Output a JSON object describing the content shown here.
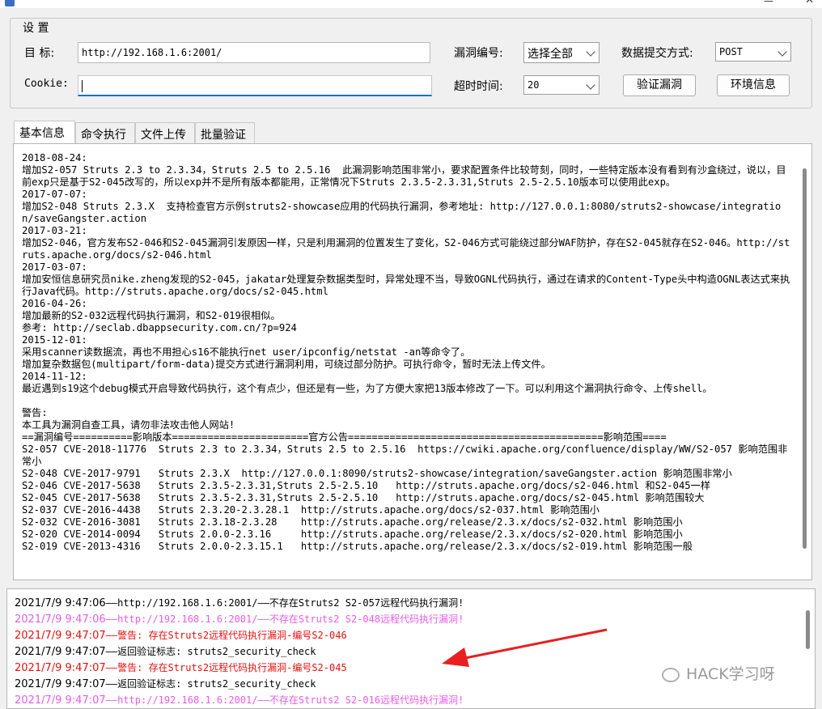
{
  "settings": {
    "legend": "设 置",
    "target_label": "目  标:",
    "target_value": "http://192.168.1.6:2001/",
    "cookie_label": "Cookie:",
    "cookie_value": "",
    "vuln_id_label": "漏洞编号:",
    "vuln_id_selected": "选择全部",
    "submit_method_label": "数据提交方式:",
    "submit_method_selected": "POST",
    "timeout_label": "超时时间:",
    "timeout_selected": "20",
    "verify_button": "验证漏洞",
    "env_button": "环境信息"
  },
  "tabs": [
    "基本信息",
    "命令执行",
    "文件上传",
    "批量验证"
  ],
  "info_text": "2018-08-24:\n增加S2-057 Struts 2.3 to 2.3.34，Struts 2.5 to 2.5.16  此漏洞影响范围非常小，要求配置条件比较苛刻，同时，一些特定版本没有看到有沙盒绕过，说以，目前exp只是基于S2-045改写的，所以exp并不是所有版本都能用，正常情况下Struts 2.3.5-2.3.31,Struts 2.5-2.5.10版本可以使用此exp。\n2017-07-07:\n增加S2-048 Struts 2.3.X  支持检查官方示例struts2-showcase应用的代码执行漏洞，参考地址: http://127.0.0.1:8080/struts2-showcase/integration/saveGangster.action\n2017-03-21:\n增加S2-046，官方发布S2-046和S2-045漏洞引发原因一样，只是利用漏洞的位置发生了变化，S2-046方式可能绕过部分WAF防护，存在S2-045就存在S2-046。http://struts.apache.org/docs/s2-046.html\n2017-03-07:\n增加安恒信息研究员nike.zheng发现的S2-045，jakatar处理复杂数据类型时，异常处理不当，导致OGNL代码执行，通过在请求的Content-Type头中构造OGNL表达式来执行Java代码。http://struts.apache.org/docs/s2-045.html\n2016-04-26:\n增加最新的S2-032远程代码执行漏洞，和S2-019很相似。\n参考: http://seclab.dbappsecurity.com.cn/?p=924\n2015-12-01:\n采用scanner读数据流，再也不用担心s16不能执行net user/ipconfig/netstat -an等命令了。\n增加复杂数据包(multipart/form-data)提交方式进行漏洞利用，可绕过部分防护。可执行命令，暂时无法上传文件。\n2014-11-12:\n最近遇到s19这个debug模式开启导致代码执行，这个有点少，但还是有一些，为了方便大家把13版本修改了一下。可以利用这个漏洞执行命令、上传shell。\n\n警告:\n本工具为漏洞自查工具，请勿非法攻击他人网站!\n==漏洞编号==========影响版本=======================官方公告===========================================影响范围====\nS2-057 CVE-2018-11776  Struts 2.3 to 2.3.34，Struts 2.5 to 2.5.16  https://cwiki.apache.org/confluence/display/WW/S2-057 影响范围非常小\nS2-048 CVE-2017-9791   Struts 2.3.X  http://127.0.0.1:8090/struts2-showcase/integration/saveGangster.action 影响范围非常小\nS2-046 CVE-2017-5638   Struts 2.3.5-2.3.31,Struts 2.5-2.5.10   http://struts.apache.org/docs/s2-046.html 和S2-045一样\nS2-045 CVE-2017-5638   Struts 2.3.5-2.3.31,Struts 2.5-2.5.10   http://struts.apache.org/docs/s2-045.html 影响范围较大\nS2-037 CVE-2016-4438   Struts 2.3.20-2.3.28.1  http://struts.apache.org/docs/s2-037.html 影响范围小\nS2-032 CVE-2016-3081   Struts 2.3.18-2.3.28    http://struts.apache.org/release/2.3.x/docs/s2-032.html 影响范围小\nS2-020 CVE-2014-0094   Struts 2.0.0-2.3.16     http://struts.apache.org/release/2.3.x/docs/s2-020.html 影响范围小\nS2-019 CVE-2013-4316   Struts 2.0.0-2.3.15.1   http://struts.apache.org/release/2.3.x/docs/s2-019.html 影响范围一般",
  "log": [
    {
      "time": "2021/7/9 9:47:06",
      "text": "——http://192.168.1.6:2001/——不存在Struts2 S2-057远程代码执行漏洞!",
      "color": "#000000"
    },
    {
      "time": "2021/7/9 9:47:06",
      "text": "——http://192.168.1.6:2001/——不存在Struts2 S2-048远程代码执行漏洞!",
      "color": "#e85ce8"
    },
    {
      "time": "2021/7/9 9:47:07",
      "text": "——警告: 存在Struts2远程代码执行漏洞-编号S2-046",
      "color": "#e81010"
    },
    {
      "time": "2021/7/9 9:47:07",
      "text": "——返回验证标志: struts2_security_check",
      "color": "#000000"
    },
    {
      "time": "2021/7/9 9:47:07",
      "text": "——警告: 存在Struts2远程代码执行漏洞-编号S2-045",
      "color": "#e81010"
    },
    {
      "time": "2021/7/9 9:47:07",
      "text": "——返回验证标志: struts2_security_check",
      "color": "#000000"
    },
    {
      "time": "2021/7/9 9:47:07",
      "text": "——http://192.168.1.6:2001/——不存在Struts2 S2-016远程代码执行漏洞!",
      "color": "#e85ce8"
    }
  ],
  "watermark": "HACK学习呀",
  "icons": {
    "wechat": "wechat-logo-icon",
    "arrow": "red-arrow-annotation"
  }
}
